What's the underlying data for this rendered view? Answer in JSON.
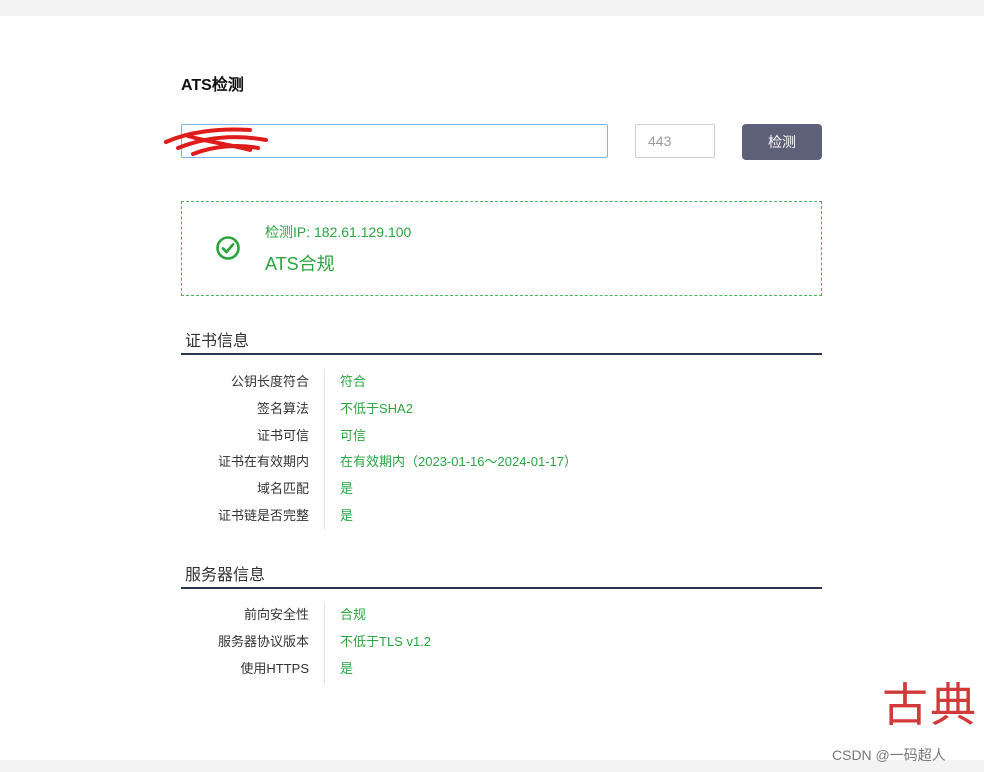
{
  "page": {
    "title": "ATS检测"
  },
  "form": {
    "host_value": "",
    "port_placeholder": "443",
    "check_label": "检测"
  },
  "result": {
    "ip_line": "检测IP: 182.61.129.100",
    "status": "ATS合规",
    "accent_color": "#2aa540"
  },
  "cert_section": {
    "title": "证书信息",
    "rows": [
      {
        "key": "公钥长度符合",
        "value": "符合"
      },
      {
        "key": "签名算法",
        "value": "不低于SHA2"
      },
      {
        "key": "证书可信",
        "value": "可信"
      },
      {
        "key": "证书在有效期内",
        "value": "在有效期内（2023-01-16～2024-01-17）"
      },
      {
        "key": "域名匹配",
        "value": "是"
      },
      {
        "key": "证书链是否完整",
        "value": "是"
      }
    ]
  },
  "server_section": {
    "title": "服务器信息",
    "rows": [
      {
        "key": "前向安全性",
        "value": "合规"
      },
      {
        "key": "服务器协议版本",
        "value": "不低于TLS v1.2"
      },
      {
        "key": "使用HTTPS",
        "value": "是"
      }
    ]
  },
  "watermark": {
    "red_text": "古典",
    "csdn_text": "CSDN @一码超人"
  }
}
